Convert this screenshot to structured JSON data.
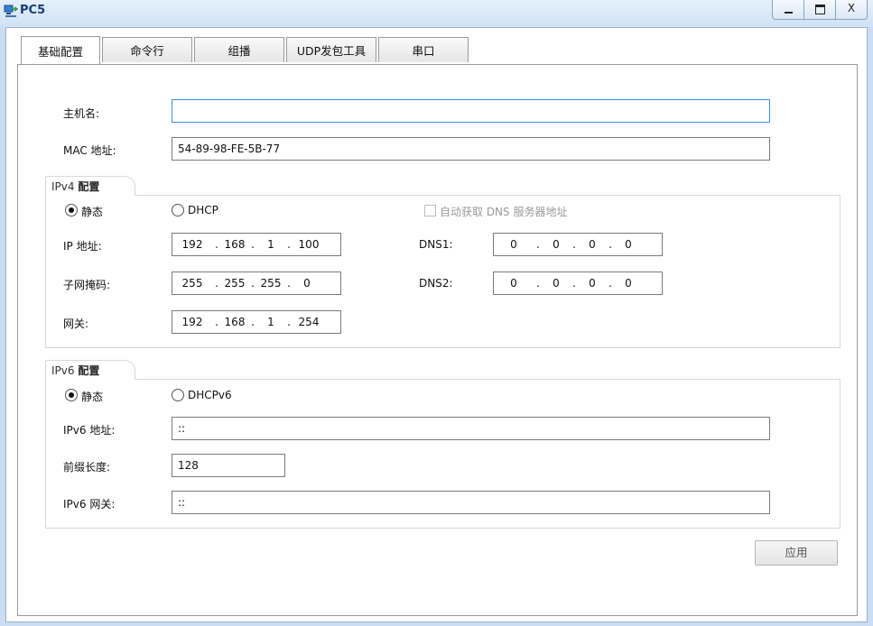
{
  "window": {
    "title": "PC5",
    "minimize_glyph": "_",
    "close_glyph": "X"
  },
  "tabs": [
    {
      "label": "基础配置",
      "active": true
    },
    {
      "label": "命令行"
    },
    {
      "label": "组播"
    },
    {
      "label": "UDP发包工具"
    },
    {
      "label": "串口"
    }
  ],
  "basic": {
    "hostname_label": "主机名:",
    "hostname_value": "",
    "mac_label": "MAC 地址:",
    "mac_value": "54-89-98-FE-5B-77"
  },
  "ipv4": {
    "group_prefix": "IPv4",
    "group_title": "配置",
    "static_label": "静态",
    "dhcp_label": "DHCP",
    "static_selected": true,
    "auto_dns_label": "自动获取 DNS 服务器地址",
    "ip_label": "IP 地址:",
    "ip": [
      "192",
      "168",
      "1",
      "100"
    ],
    "mask_label": "子网掩码:",
    "mask": [
      "255",
      "255",
      "255",
      "0"
    ],
    "gateway_label": "网关:",
    "gateway": [
      "192",
      "168",
      "1",
      "254"
    ],
    "dns1_label": "DNS1:",
    "dns1": [
      "0",
      "0",
      "0",
      "0"
    ],
    "dns2_label": "DNS2:",
    "dns2": [
      "0",
      "0",
      "0",
      "0"
    ]
  },
  "ipv6": {
    "group_prefix": "IPv6",
    "group_title": "配置",
    "static_label": "静态",
    "dhcp_label": "DHCPv6",
    "static_selected": true,
    "addr_label": "IPv6 地址:",
    "addr_value": "::",
    "prefix_label": "前缀长度:",
    "prefix_value": "128",
    "gateway_label": "IPv6 网关:",
    "gateway_value": "::"
  },
  "apply_button": "应用",
  "colors": {
    "title_text": "#1a3c6e",
    "focus_border": "#3d8ee0",
    "window_frame": "#c9def5"
  }
}
